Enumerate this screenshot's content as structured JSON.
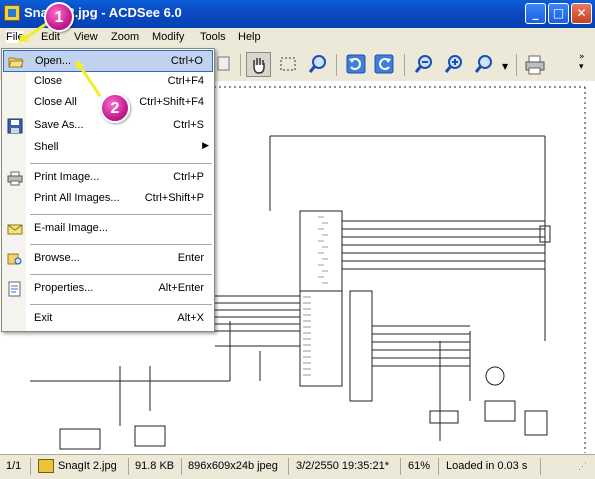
{
  "window": {
    "title": "SnagIt 2.jpg - ACDSee 6.0",
    "controls": [
      "_",
      "□",
      "✕"
    ]
  },
  "menubar": {
    "items": [
      "File",
      "Edit",
      "View",
      "Zoom",
      "Modify",
      "Tools",
      "Help"
    ]
  },
  "file_menu": {
    "items": [
      {
        "label": "Open...",
        "shortcut": "Ctrl+O",
        "icon": "open-folder-icon"
      },
      {
        "label": "Close",
        "shortcut": "Ctrl+F4",
        "icon": ""
      },
      {
        "label": "Close All",
        "shortcut": "Ctrl+Shift+F4",
        "icon": ""
      },
      {
        "label": "Save As...",
        "shortcut": "Ctrl+S",
        "icon": "floppy-disk-icon"
      },
      {
        "label": "Shell",
        "shortcut": "",
        "icon": ""
      },
      {
        "label": "Print Image...",
        "shortcut": "Ctrl+P",
        "icon": "printer-icon"
      },
      {
        "label": "Print All Images...",
        "shortcut": "Ctrl+Shift+P",
        "icon": ""
      },
      {
        "label": "E-mail Image...",
        "shortcut": "",
        "icon": "email-icon"
      },
      {
        "label": "Browse...",
        "shortcut": "Enter",
        "icon": "browse-icon"
      },
      {
        "label": "Properties...",
        "shortcut": "Alt+Enter",
        "icon": "properties-icon"
      },
      {
        "label": "Exit",
        "shortcut": "Alt+X",
        "icon": ""
      }
    ]
  },
  "annotations": {
    "step1": "1",
    "step2": "2"
  },
  "statusbar": {
    "index": "1/1",
    "filename": "SnagIt 2.jpg",
    "filesize": "91.8 KB",
    "dimensions": "896x609x24b jpeg",
    "date": "3/2/2550 19:35:21*",
    "zoom": "61%",
    "load_time": "Loaded in 0.03 s"
  },
  "colors": {
    "titlebar": "#0b49c2",
    "menu_highlight": "#c1d2ee",
    "badge": "#c41e91",
    "arrow": "#f2ec2a"
  }
}
